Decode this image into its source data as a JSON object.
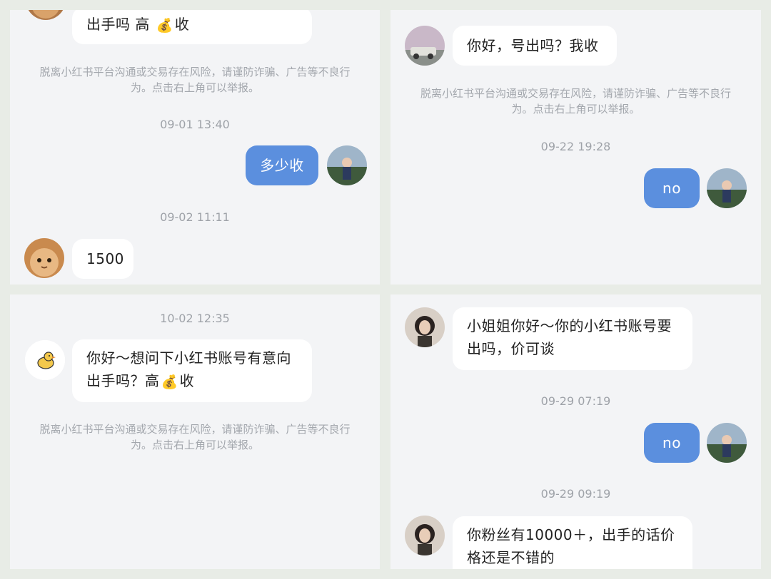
{
  "panels": {
    "p1": {
      "top_msg_text": "出手吗 高",
      "top_msg_suffix": "收",
      "warning": "脱离小红书平台沟通或交易存在风险，请谨防诈骗、广告等不良行为。点击右上角可以举报。",
      "time1": "09-01 13:40",
      "my_msg": "多少收",
      "time2": "09-02 11:11",
      "reply": "1500"
    },
    "p2": {
      "incoming_msg": "你好，号出吗？我收",
      "warning": "脱离小红书平台沟通或交易存在风险，请谨防诈骗、广告等不良行为。点击右上角可以举报。",
      "time1": "09-22 19:28",
      "my_msg": "no"
    },
    "p3": {
      "time1": "10-02 12:35",
      "incoming_line1": "你好～想问下小红书账号有意向",
      "incoming_line2_prefix": "出手吗？高",
      "incoming_line2_suffix": "收",
      "warning": "脱离小红书平台沟通或交易存在风险，请谨防诈骗、广告等不良行为。点击右上角可以举报。"
    },
    "p4": {
      "incoming_line1": "小姐姐你好～你的小红书账号要",
      "incoming_line2": "出吗，价可谈",
      "time1": "09-29 07:19",
      "my_msg": "no",
      "time2": "09-29 09:19",
      "incoming2_line1": "你粉丝有10000＋，出手的话价",
      "incoming2_line2": "格还是不错的"
    }
  },
  "icons": {
    "money": "money-bag-icon",
    "duck": "duck-icon"
  },
  "colors": {
    "sent_bubble": "#5b8fde",
    "received_bubble": "#ffffff",
    "panel_bg": "#f3f4f6"
  }
}
